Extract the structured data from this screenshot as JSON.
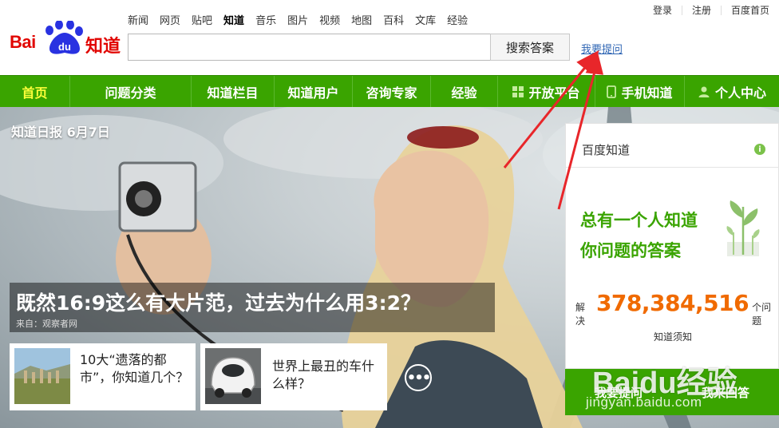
{
  "header": {
    "logo_text": "Baidu知道",
    "logo_parts": {
      "bai": "Bai",
      "du": "du",
      "zhidao": "知道"
    },
    "top_nav": [
      "新闻",
      "网页",
      "贴吧",
      "知道",
      "音乐",
      "图片",
      "视频",
      "地图",
      "百科",
      "文库",
      "经验"
    ],
    "active_top_nav": "知道",
    "user_links": [
      "登录",
      "注册",
      "百度首页"
    ],
    "search": {
      "value": "",
      "placeholder": "",
      "button_label": "搜索答案"
    },
    "ask_link": "我要提问"
  },
  "main_nav": {
    "items": [
      {
        "label": "首页",
        "active": true
      },
      {
        "label": "问题分类"
      },
      {
        "label": "知道栏目"
      },
      {
        "label": "知道用户"
      },
      {
        "label": "咨询专家"
      },
      {
        "label": "经验"
      },
      {
        "label": "开放平台",
        "icon": "grid-icon"
      },
      {
        "label": "手机知道",
        "icon": "phone-icon"
      },
      {
        "label": "个人中心",
        "icon": "user-icon"
      }
    ],
    "colors": {
      "background": "#3aa400",
      "active_text": "#ffff3a"
    }
  },
  "hero": {
    "daily_label": "知道日报 6月7日",
    "headline": "既然16:9这么有大片范，过去为什么用3:2？",
    "source": "来自：观察者网",
    "cards": [
      {
        "text": "10大“遗落的都市”，你知道几个？",
        "thumb": "ruins-thumbnail"
      },
      {
        "text": "世界上最丑的车什么样？",
        "thumb": "car-thumbnail"
      }
    ],
    "more_icon": "more-dots-icon"
  },
  "side_panel": {
    "title": "百度知道",
    "info_icon": "i",
    "slogan_line1": "总有一个人知道",
    "slogan_line2": "你问题的答案",
    "solved_prefix": "解决",
    "solved_count": "378,384,516",
    "solved_suffix": "个问题",
    "notice_link": "知道须知",
    "ask_button": "我要提问",
    "answer_button": "我来回答"
  },
  "watermark": {
    "logo": "Baidu经验",
    "url": "jingyan.baidu.com"
  },
  "colors": {
    "brand_red": "#e10602",
    "brand_blue": "#2932e1",
    "green": "#3aa400",
    "orange": "#f06a00",
    "arrow_red": "#e8262a",
    "link_blue": "#2d64b3"
  }
}
